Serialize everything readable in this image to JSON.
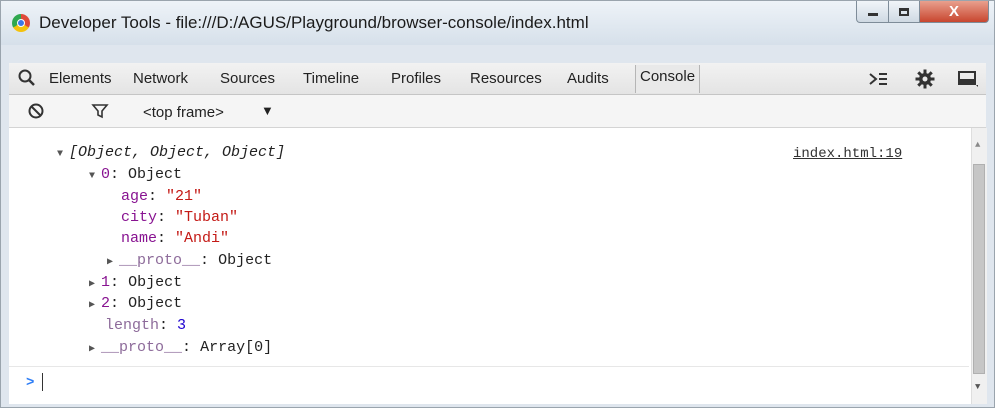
{
  "window": {
    "title": "Developer Tools - file:///D:/AGUS/Playground/browser-console/index.html",
    "close_label": "X"
  },
  "toolbar": {
    "tabs": [
      "Elements",
      "Network",
      "Sources",
      "Timeline",
      "Profiles",
      "Resources",
      "Audits",
      "Console"
    ],
    "active_tab": "Console"
  },
  "subbar": {
    "frame": "<top frame>"
  },
  "console": {
    "source_link": "index.html:19",
    "array_summary": "[Object, Object, Object]",
    "item0_key": "0",
    "item0_type": "Object",
    "props": [
      {
        "key": "age",
        "value": "\"21\""
      },
      {
        "key": "city",
        "value": "\"Tuban\""
      },
      {
        "key": "name",
        "value": "\"Andi\""
      }
    ],
    "proto_key": "__proto__",
    "proto0_type": "Object",
    "item1_key": "1",
    "item1_type": "Object",
    "item2_key": "2",
    "item2_type": "Object",
    "length_key": "length",
    "length_value": "3",
    "array_proto_type": "Array[0]",
    "prompt": ">"
  },
  "colors": {
    "key": "#881391",
    "string": "#c41a16",
    "number": "#1c00cf",
    "prompt": "#2d7df6"
  }
}
